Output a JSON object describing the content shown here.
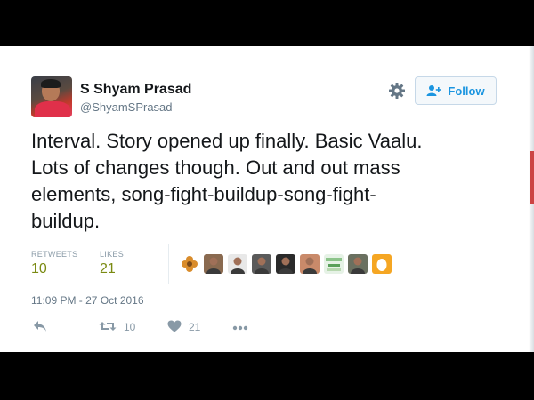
{
  "tweet": {
    "author": {
      "name": "S Shyam Prasad",
      "handle": "@ShyamSPrasad"
    },
    "follow_label": "Follow",
    "text": "Interval. Story opened up finally. Basic Vaalu.\nLots of changes though. Out and out mass\nelements, song-fight-buildup-song-fight-\nbuildup.",
    "stats": {
      "retweets_label": "RETWEETS",
      "retweets": "10",
      "likes_label": "LIKES",
      "likes": "21"
    },
    "liker_avatars": [
      {
        "icon": "flower-avatar-icon",
        "color": "#d98c2b"
      },
      {
        "icon": "person-avatar-icon",
        "color": "#8a6a50"
      },
      {
        "icon": "person-avatar-icon",
        "color": "#e8e8e8"
      },
      {
        "icon": "person-avatar-icon",
        "color": "#5a5a5a"
      },
      {
        "icon": "person-avatar-icon",
        "color": "#2a2a2a"
      },
      {
        "icon": "person-avatar-icon",
        "color": "#c98a6a"
      },
      {
        "icon": "landscape-avatar-icon",
        "color": "#8cc48a"
      },
      {
        "icon": "person-avatar-icon",
        "color": "#6a7060"
      },
      {
        "icon": "egg-avatar-icon",
        "color": "#f5a623"
      }
    ],
    "timestamp": "11:09 PM - 27 Oct 2016",
    "actions": {
      "retweet_count": "10",
      "like_count": "21"
    }
  },
  "colors": {
    "accent": "#1b95e0",
    "stat_value": "#7a8a12",
    "muted": "#657786"
  }
}
